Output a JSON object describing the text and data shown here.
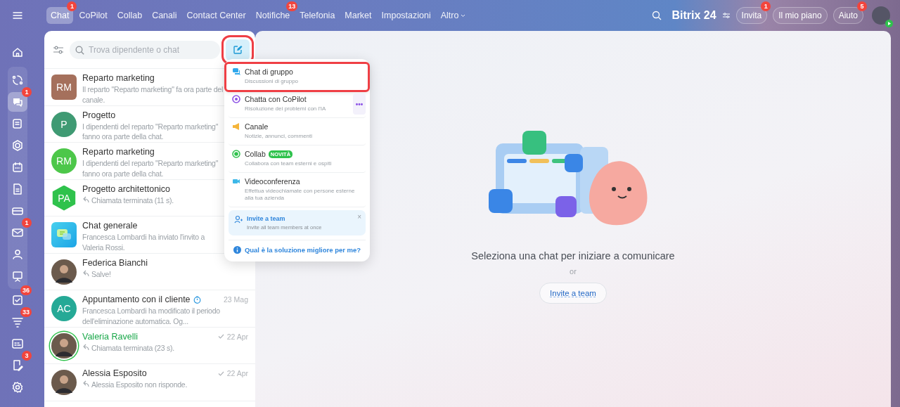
{
  "top_nav": {
    "items": [
      {
        "label": "Chat",
        "selected": true,
        "badge": "1"
      },
      {
        "label": "CoPilot",
        "selected": false
      },
      {
        "label": "Collab",
        "selected": false
      },
      {
        "label": "Canali",
        "selected": false
      },
      {
        "label": "Contact Center",
        "selected": false
      },
      {
        "label": "Notifiche",
        "selected": false,
        "badge": "13"
      },
      {
        "label": "Telefonia",
        "selected": false
      },
      {
        "label": "Market",
        "selected": false
      },
      {
        "label": "Impostazioni",
        "selected": false
      },
      {
        "label": "Altro",
        "selected": false,
        "dropdown": true
      }
    ],
    "logo": "Bitrix 24",
    "buttons": [
      {
        "label": "Invita",
        "badge": "1"
      },
      {
        "label": "Il mio piano"
      },
      {
        "label": "Aiuto",
        "badge": "5"
      }
    ]
  },
  "sidebar": {
    "items": [
      {
        "selected": false
      },
      {
        "selected": false
      },
      {
        "selected": true,
        "badge": "1"
      },
      {
        "selected": false
      },
      {
        "selected": false
      },
      {
        "selected": false
      },
      {
        "selected": false
      },
      {
        "selected": false
      },
      {
        "selected": false,
        "badge": "1"
      },
      {
        "selected": false
      },
      {
        "selected": false
      },
      {
        "selected": false,
        "badge": "36"
      },
      {
        "selected": false,
        "badge": "33"
      },
      {
        "selected": false
      },
      {
        "selected": false,
        "badge": "3"
      },
      {
        "selected": false
      }
    ]
  },
  "chat_panel": {
    "search": {
      "placeholder": "Trova dipendente o chat"
    },
    "compose_highlighted": true,
    "chats": [
      {
        "name": "Reparto marketing",
        "preview": "Il reparto \"Reparto marketing\" fa ora parte del canale.",
        "avatar": {
          "kind": "square",
          "initials": "RM",
          "color": "#a5705c"
        }
      },
      {
        "name": "Progetto",
        "preview": "I dipendenti del reparto \"Reparto marketing\" fanno ora parte della chat.",
        "avatar": {
          "kind": "circle",
          "initials": "P",
          "color": "#3f9a73"
        }
      },
      {
        "name": "Reparto marketing",
        "preview": "I dipendenti del reparto \"Reparto marketing\" fanno ora parte della chat.",
        "avatar": {
          "kind": "circle",
          "initials": "RM",
          "color": "#4dc74a"
        }
      },
      {
        "name": "Progetto architettonico",
        "preview": "Chiamata terminata (11 s).",
        "reply": true,
        "avatar": {
          "kind": "hexagon",
          "initials": "PA",
          "color": "#2fc24c"
        }
      },
      {
        "name": "Chat generale",
        "preview": "Francesca Lombardi ha inviato l'invito a Valeria Rossi.",
        "avatar": {
          "kind": "chat-icon"
        }
      },
      {
        "name": "Federica Bianchi",
        "preview": "Salve!",
        "reply": true,
        "avatar": {
          "kind": "photo"
        }
      },
      {
        "name": "Appuntamento con il cliente",
        "timer": true,
        "date": "23 Mag",
        "preview": "Francesca Lombardi ha modificato il periodo dell'eliminazione automatica. Og...",
        "avatar": {
          "kind": "circle",
          "initials": "AC",
          "color": "#25a996"
        }
      },
      {
        "name": "Valeria Ravelli",
        "online": true,
        "read": true,
        "date": "22 Apr",
        "preview": "Chiamata terminata (23 s).",
        "reply": true,
        "avatar": {
          "kind": "photo"
        }
      },
      {
        "name": "Alessia Esposito",
        "read": true,
        "date": "22 Apr",
        "preview": "Alessia Esposito non risponde.",
        "reply": true,
        "avatar": {
          "kind": "photo"
        }
      }
    ]
  },
  "create_menu": {
    "items": [
      {
        "kind": "group-chat",
        "title": "Chat di gruppo",
        "subtitle": "Discussioni di gruppo",
        "highlighted": true
      },
      {
        "kind": "copilot",
        "title": "Chatta con CoPilot",
        "subtitle": "Risoluzione dei problemi con l'IA",
        "more": "•••",
        "highlighted": false
      },
      {
        "kind": "channel",
        "title": "Canale",
        "subtitle": "Notizie, annunci, commenti",
        "highlighted": false
      },
      {
        "kind": "collab",
        "title": "Collab",
        "badge": "NOVITÀ",
        "subtitle": "Collabora con team esterni e ospiti",
        "highlighted": false
      },
      {
        "kind": "video",
        "title": "Videoconferenza",
        "subtitle": "Effettua videochiamate con persone esterne alla tua azienda",
        "highlighted": false
      }
    ],
    "invite_card": {
      "title": "Invite a team",
      "subtitle": "Invite all team members at once",
      "close": "×"
    },
    "help_link": "Qual è la soluzione migliore per me?"
  },
  "empty_state": {
    "title": "Seleziona una chat per iniziare a comunicare",
    "separator": "or",
    "button": "Invite a team"
  }
}
